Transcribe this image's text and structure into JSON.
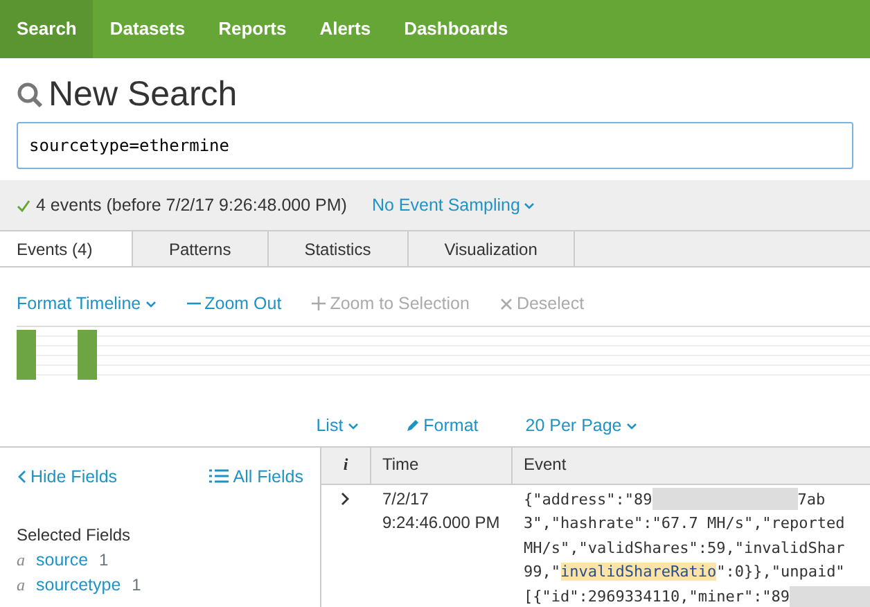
{
  "nav": [
    {
      "label": "Search",
      "selected": true
    },
    {
      "label": "Datasets",
      "selected": false
    },
    {
      "label": "Reports",
      "selected": false
    },
    {
      "label": "Alerts",
      "selected": false
    },
    {
      "label": "Dashboards",
      "selected": false
    }
  ],
  "title": "New Search",
  "search": {
    "value": "sourcetype=ethermine"
  },
  "status": {
    "text": "4 events (before 7/2/17 9:26:48.000 PM)",
    "sampling": "No Event Sampling"
  },
  "tabs": [
    {
      "label": "Events (4)",
      "selected": true
    },
    {
      "label": "Patterns",
      "selected": false
    },
    {
      "label": "Statistics",
      "selected": false
    },
    {
      "label": "Visualization",
      "selected": false
    }
  ],
  "timeline_actions": [
    {
      "kind": "dropdown",
      "label": "Format Timeline",
      "disabled": false
    },
    {
      "kind": "minus",
      "label": "Zoom Out",
      "disabled": false
    },
    {
      "kind": "plus",
      "label": "Zoom to Selection",
      "disabled": true
    },
    {
      "kind": "cross",
      "label": "Deselect",
      "disabled": true
    }
  ],
  "view_options": [
    {
      "kind": "dropdown",
      "label": "List"
    },
    {
      "kind": "pencil",
      "label": "Format"
    },
    {
      "kind": "dropdown",
      "label": "20 Per Page"
    }
  ],
  "sidebar": {
    "hide": "Hide Fields",
    "all": "All Fields",
    "heading": "Selected Fields",
    "fields": [
      {
        "type": "a",
        "name": "source",
        "count": "1"
      },
      {
        "type": "a",
        "name": "sourcetype",
        "count": "1"
      }
    ]
  },
  "table": {
    "columns": [
      "i",
      "Time",
      "Event"
    ],
    "rows": [
      {
        "expanded": false,
        "time": [
          "7/2/17",
          "9:24:46.000 PM"
        ],
        "lines": [
          [
            {
              "kind": "text",
              "text": "{\"address\":\"89"
            },
            {
              "kind": "redacted"
            },
            {
              "kind": "text",
              "text": "7ab"
            }
          ],
          [
            {
              "kind": "text",
              "text": "3\",\"hashrate\":\"67.7 MH/s\",\"reported"
            }
          ],
          [
            {
              "kind": "text",
              "text": "MH/s\",\"validShares\":59,\"invalidShar"
            }
          ],
          [
            {
              "kind": "text",
              "text": "99,\""
            },
            {
              "kind": "highlight",
              "text": "invalidShareRatio"
            },
            {
              "kind": "text",
              "text": "\":0}},\"unpaid\""
            }
          ],
          [
            {
              "kind": "text",
              "text": "[{\"id\":2969334110,\"miner\":\"89"
            },
            {
              "kind": "redacted"
            }
          ]
        ]
      }
    ]
  }
}
